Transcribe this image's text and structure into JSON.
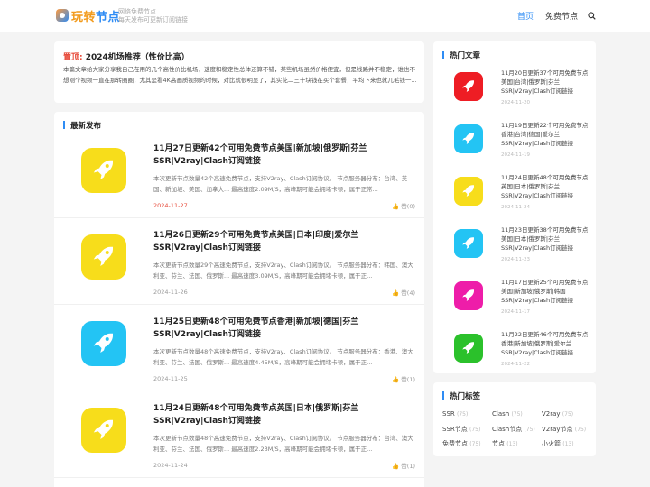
{
  "header": {
    "logo_a": "玩转",
    "logo_b": "节点",
    "tagline_1": "网络免费节点",
    "tagline_2": "每天发布可更新订阅链接",
    "nav": [
      "首页",
      "免费节点"
    ]
  },
  "notice": {
    "prefix": "置顶:",
    "title": "2024机场推荐（性价比高）",
    "body": "本篇文章给大家分享我自己在用的几个高性价比机场，速度和稳定性总体还算不错，某些机场虽然价格便宜，但是线路并不稳定，谁也不想刚个视频一直在那转圈圈，尤其是看4K高画质视频的时候，对比就很明显了，其实花二三十块钱在买个套餐，平均下来也就几毛钱一..."
  },
  "latest": {
    "heading": "最新发布",
    "posts": [
      {
        "title": "11月27日更新42个可用免费节点美国|新加坡|俄罗斯|芬兰SSR|V2ray|Clash订阅链接",
        "excerpt": "本次更新节点数量42个高速免费节点，支持V2ray、Clash订阅协议。 节点服务器分布：台湾、英国、新加坡、美国、加拿大... 最高速度2.09M/S，高峰期可能会拥堵卡顿，属于正常...",
        "date": "2024-11-27",
        "likes": "赞(0)"
      },
      {
        "title": "11月26日更新29个可用免费节点美国|日本|印度|爱尔兰SSR|V2ray|Clash订阅链接",
        "excerpt": "本次更新节点数量29个高速免费节点，支持V2ray、Clash订阅协议。 节点服务器分布：韩国、澳大利亚、芬兰、法国、俄罗斯... 最高速度3.09M/S，高峰期可能会拥堵卡顿，属于正...",
        "date": "2024-11-26",
        "likes": "赞(4)"
      },
      {
        "title": "11月25日更新48个可用免费节点香港|新加坡|德国|芬兰SSR|V2ray|Clash订阅链接",
        "excerpt": "本次更新节点数量48个高速免费节点，支持V2ray、Clash订阅协议。 节点服务器分布：香港、澳大利亚、芬兰、法国、俄罗斯... 最高速度4.45M/S，高峰期可能会拥堵卡顿，属于正...",
        "date": "2024-11-25",
        "likes": "赞(1)"
      },
      {
        "title": "11月24日更新48个可用免费节点英国|日本|俄罗斯|芬兰SSR|V2ray|Clash订阅链接",
        "excerpt": "本次更新节点数量48个高速免费节点，支持V2ray、Clash订阅协议。 节点服务器分布：台湾、澳大利亚、芬兰、法国、俄罗斯... 最高速度2.23M/S，高峰期可能会拥堵卡顿，属于正...",
        "date": "2024-11-24",
        "likes": "赞(1)"
      }
    ]
  },
  "hot": {
    "heading": "热门文章",
    "items": [
      {
        "title": "11月20日更新37个可用免费节点美国|台湾|俄罗斯|芬兰SSR|V2ray|Clash订阅链接",
        "date": "2024-11-20",
        "color": "#ee1d24"
      },
      {
        "title": "11月19日更新22个可用免费节点香港|台湾|德国|爱尔兰SSR|V2ray|Clash订阅链接",
        "date": "2024-11-19",
        "color": "#23c4f4"
      },
      {
        "title": "11月24日更新48个可用免费节点英国|日本|俄罗斯|芬兰SSR|V2ray|Clash订阅链接",
        "date": "2024-11-24",
        "color": "#f7dd1b"
      },
      {
        "title": "11月23日更新38个可用免费节点美国|日本|俄罗斯|芬兰SSR|V2ray|Clash订阅链接",
        "date": "2024-11-23",
        "color": "#23c4f4"
      },
      {
        "title": "11月17日更新25个可用免费节点美国|新加坡|俄罗斯|韩国SSR|V2ray|Clash订阅链接",
        "date": "2024-11-17",
        "color": "#ee1da9"
      },
      {
        "title": "11月22日更新46个可用免费节点香港|新加坡|俄罗斯|爱尔兰SSR|V2ray|Clash订阅链接",
        "date": "2024-11-22",
        "color": "#2bc12b"
      }
    ]
  },
  "tags": {
    "heading": "热门标签",
    "items": [
      {
        "name": "SSR",
        "count": "(75)"
      },
      {
        "name": "Clash",
        "count": "(75)"
      },
      {
        "name": "V2ray",
        "count": "(75)"
      },
      {
        "name": "SSR节点",
        "count": "(75)"
      },
      {
        "name": "Clash节点",
        "count": "(75)"
      },
      {
        "name": "V2ray节点",
        "count": "(75)"
      },
      {
        "name": "免费节点",
        "count": "(75)"
      },
      {
        "name": "节点",
        "count": "(13)"
      },
      {
        "name": "小火箭",
        "count": "(13)"
      }
    ]
  },
  "colors": {
    "accent": "#2f8cf4",
    "latest_thumbs": [
      "#f7dd1b",
      "#f7dd1b",
      "#23c4f4",
      "#f7dd1b"
    ]
  }
}
